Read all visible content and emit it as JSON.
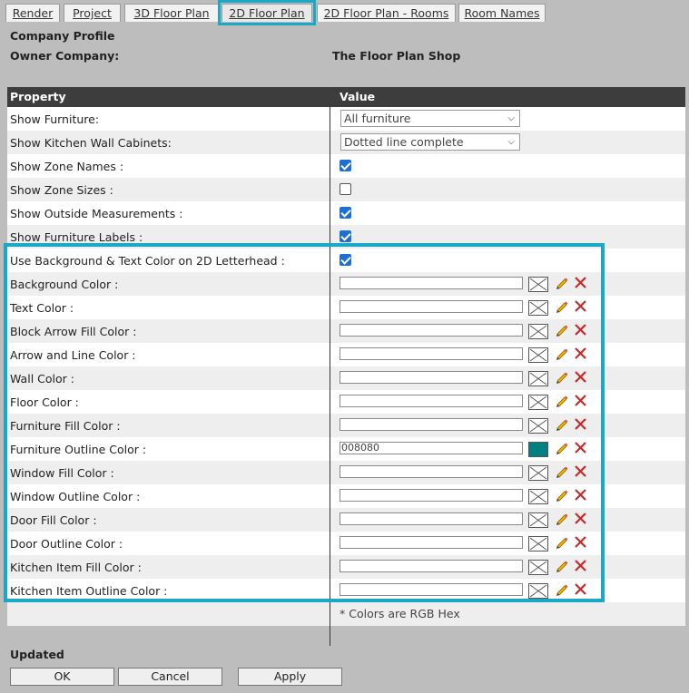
{
  "tabs": [
    {
      "label": "Render"
    },
    {
      "label": "Project"
    },
    {
      "label": "3D Floor Plan"
    },
    {
      "label": "2D Floor Plan"
    },
    {
      "label": "2D Floor Plan - Rooms"
    },
    {
      "label": "Room Names"
    }
  ],
  "header": {
    "section_title": "Company Profile",
    "owner_label": "Owner Company:",
    "owner_value": "The Floor Plan Shop"
  },
  "table": {
    "col_property": "Property",
    "col_value": "Value",
    "show_furniture": {
      "label": "Show Furniture:",
      "value": "All furniture"
    },
    "show_cabinets": {
      "label": "Show Kitchen Wall Cabinets:",
      "value": "Dotted line complete"
    },
    "checks": [
      {
        "label": "Show Zone Names :",
        "checked": true
      },
      {
        "label": "Show Zone Sizes :",
        "checked": false
      },
      {
        "label": "Show Outside Measurements :",
        "checked": true
      },
      {
        "label": "Show Furniture Labels :",
        "checked": true
      },
      {
        "label": "Use Background & Text Color on 2D Letterhead :",
        "checked": true
      }
    ],
    "colors": [
      {
        "label": "Background Color :",
        "value": ""
      },
      {
        "label": "Text Color :",
        "value": ""
      },
      {
        "label": "Block Arrow Fill Color :",
        "value": ""
      },
      {
        "label": "Arrow and Line Color :",
        "value": ""
      },
      {
        "label": "Wall Color :",
        "value": ""
      },
      {
        "label": "Floor Color :",
        "value": ""
      },
      {
        "label": "Furniture Fill Color :",
        "value": ""
      },
      {
        "label": "Furniture Outline Color :",
        "value": "008080",
        "swatch": "#008080"
      },
      {
        "label": "Window Fill Color :",
        "value": ""
      },
      {
        "label": "Window Outline Color :",
        "value": ""
      },
      {
        "label": "Door Fill Color :",
        "value": ""
      },
      {
        "label": "Door Outline Color :",
        "value": ""
      },
      {
        "label": "Kitchen Item Fill Color :",
        "value": ""
      },
      {
        "label": "Kitchen Item Outline Color :",
        "value": ""
      }
    ],
    "note": "* Colors are RGB Hex"
  },
  "status": "Updated",
  "buttons": {
    "ok": "OK",
    "cancel": "Cancel",
    "apply": "Apply"
  },
  "accent": "#1ba8c6"
}
